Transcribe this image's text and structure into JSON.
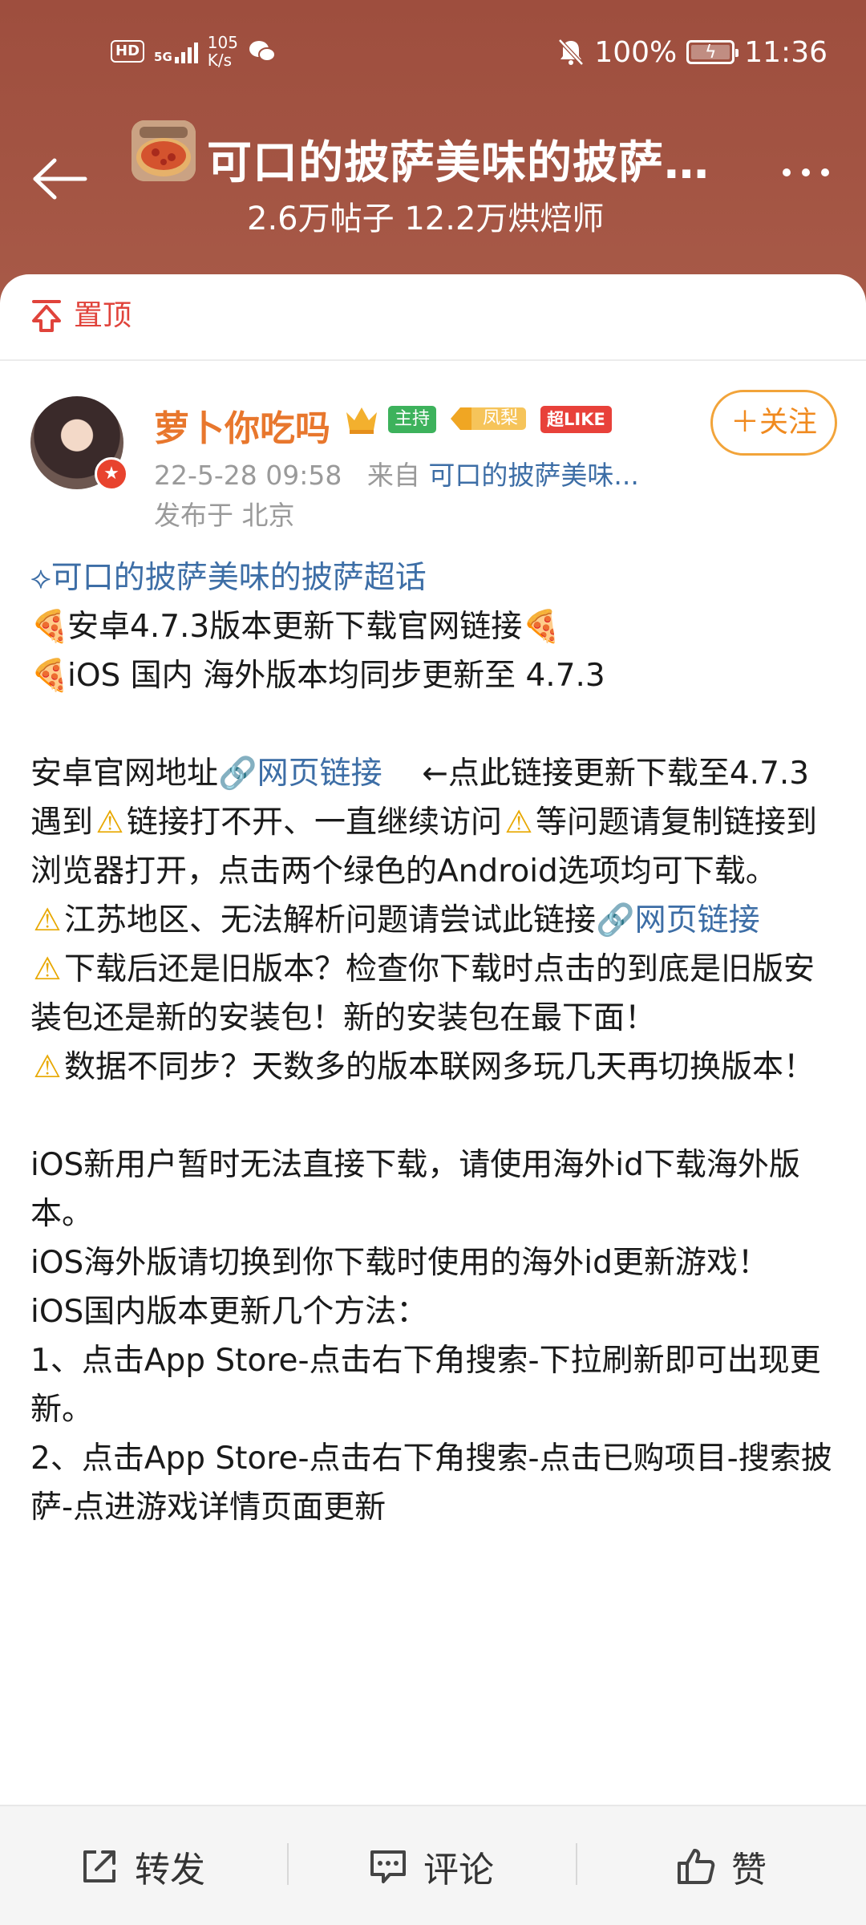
{
  "status_bar": {
    "hd": "HD",
    "network": "5G",
    "speed_value": "105",
    "speed_unit": "K/s",
    "battery": "100%",
    "time": "11:36"
  },
  "header": {
    "title": "可口的披萨美味的披萨…",
    "subtitle": "2.6万帖子 12.2万烘焙师"
  },
  "pinned": {
    "label": "置顶"
  },
  "post": {
    "author": "萝卜你吃吗",
    "badge_host": "主持",
    "badge_fan": "凤梨",
    "badge_like": "超LIKE",
    "follow_label": "＋关注",
    "date": "22-5-28 09:58",
    "from_prefix": "来自",
    "from_source": "可口的披萨美味...",
    "location": "发布于 北京",
    "lines": {
      "topic": "可口的披萨美味的披萨超话",
      "l1": "安卓4.7.3版本更新下载官网链接",
      "l2": "iOS 国内 海外版本均同步更新至 4.7.3",
      "l3a": "安卓官网地址",
      "l3link": "网页链接",
      "l3b": "←点此链接更新下载至4.7.3",
      "l4a": "遇到",
      "l4b": "链接打不开、一直继续访问",
      "l4c": "等问题请复制链接到浏览器打开，点击两个绿色的Android选项均可下载。",
      "l5a": "江苏地区、无法解析问题请尝试此链接",
      "l5link": "网页链接",
      "l6": "下载后还是旧版本？检查你下载时点击的到底是旧版安装包还是新的安装包！新的安装包在最下面！",
      "l7": "数据不同步？天数多的版本联网多玩几天再切换版本！",
      "l8": "iOS新用户暂时无法直接下载，请使用海外id下载海外版本。",
      "l9": "iOS海外版请切换到你下载时使用的海外id更新游戏！",
      "l10": "iOS国内版本更新几个方法：",
      "l11": "1、点击App Store-点击右下角搜索-下拉刷新即可出现更新。",
      "l12": "2、点击App Store-点击右下角搜索-点击已购项目-搜索披萨-点进游戏详情页面更新"
    }
  },
  "bottom_bar": {
    "repost": "转发",
    "comment": "评论",
    "like": "赞"
  }
}
